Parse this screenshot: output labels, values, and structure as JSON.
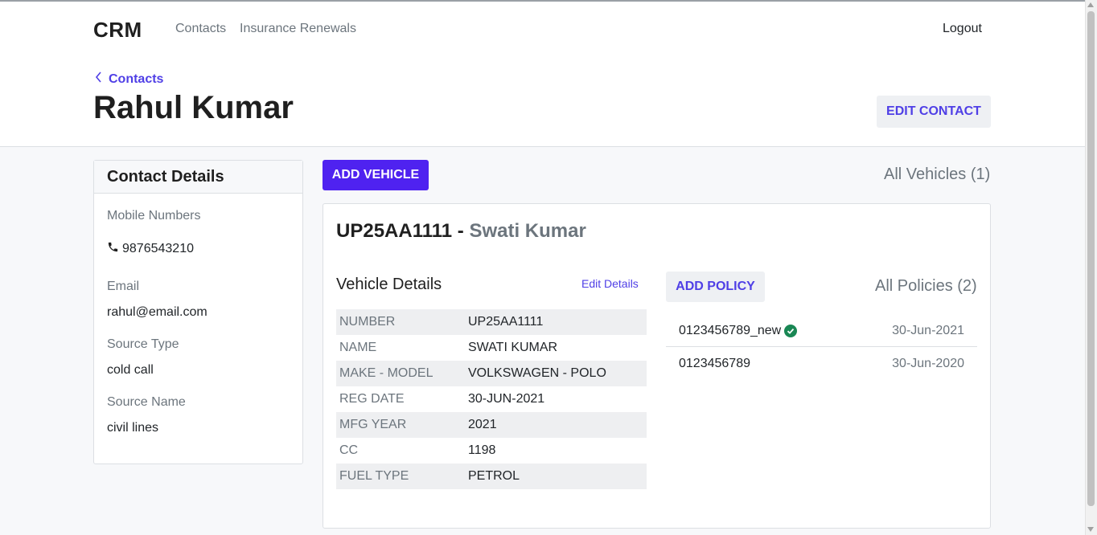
{
  "nav": {
    "brand": "CRM",
    "links": [
      "Contacts",
      "Insurance Renewals"
    ],
    "logout": "Logout"
  },
  "header": {
    "breadcrumb": "Contacts",
    "title": "Rahul Kumar",
    "edit_button": "EDIT CONTACT"
  },
  "contact_details": {
    "heading": "Contact Details",
    "mobile_label": "Mobile Numbers",
    "mobile": "9876543210",
    "email_label": "Email",
    "email": "rahul@email.com",
    "source_type_label": "Source Type",
    "source_type": "cold call",
    "source_name_label": "Source Name",
    "source_name": "civil lines"
  },
  "vehicles": {
    "add_button": "ADD VEHICLE",
    "all_link": "All Vehicles (1)",
    "number": "UP25AA1111",
    "separator": " - ",
    "owner": "Swati Kumar",
    "details_heading": "Vehicle Details",
    "edit_details": "Edit Details",
    "rows": [
      {
        "key": "NUMBER",
        "value": "UP25AA1111"
      },
      {
        "key": "NAME",
        "value": "SWATI KUMAR"
      },
      {
        "key": "MAKE - MODEL",
        "value": "VOLKSWAGEN - POLO"
      },
      {
        "key": "REG DATE",
        "value": "30-JUN-2021"
      },
      {
        "key": "MFG YEAR",
        "value": "2021"
      },
      {
        "key": "CC",
        "value": "1198"
      },
      {
        "key": "FUEL TYPE",
        "value": "PETROL"
      }
    ]
  },
  "policies": {
    "add_button": "ADD POLICY",
    "all_link": "All Policies (2)",
    "items": [
      {
        "number": "0123456789_new",
        "date": "30-Jun-2021",
        "active": true
      },
      {
        "number": "0123456789",
        "date": "30-Jun-2020",
        "active": false
      }
    ]
  },
  "colors": {
    "accent": "#4f22f0",
    "link": "#4f3fe6",
    "active_check": "#198754"
  },
  "icons": {
    "phone": "phone-icon",
    "back": "chevron-left-icon",
    "active": "check-circle-icon"
  }
}
